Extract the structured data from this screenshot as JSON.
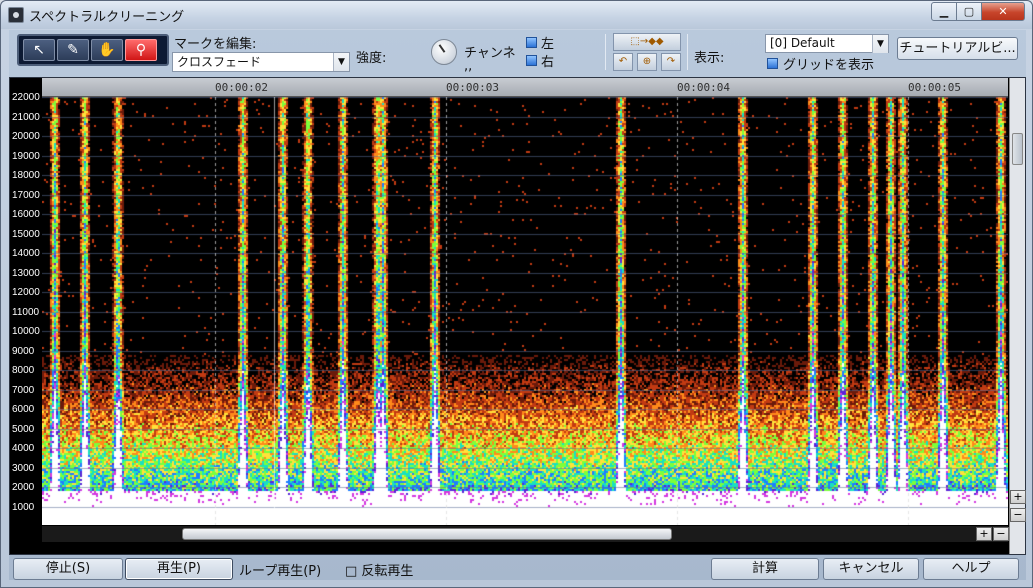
{
  "window": {
    "title": "スペクトラルクリーニング",
    "min": "▁",
    "max": "▢",
    "close": "✕"
  },
  "tools": [
    {
      "name": "pointer-tool",
      "glyph": "↖"
    },
    {
      "name": "brush-tool",
      "glyph": "✎"
    },
    {
      "name": "hand-tool",
      "glyph": "✋"
    },
    {
      "name": "zoom-tool",
      "glyph": "⚲"
    }
  ],
  "toolbar": {
    "mark_edit_label": "マークを編集:",
    "mark_edit_value": "クロスフェード",
    "strength_label": "強度:",
    "channel_label": "チャンネ\n,,",
    "left_label": "左",
    "right_label": "右",
    "view_label": "表示:",
    "preset_value": "[0] Default",
    "grid_label": "グリッドを表示",
    "tutorial_label": "チュートリアルビ..."
  },
  "icons": {
    "mark_arrow": "⬚→◆◆",
    "b1": "↶",
    "b2": "⊕",
    "b3": "↷"
  },
  "timeline": {
    "labels": [
      "00:00:02",
      "00:00:03",
      "00:00:04",
      "00:00:05"
    ]
  },
  "y_axis": {
    "labels": [
      "22000",
      "21000",
      "20000",
      "19000",
      "18000",
      "17000",
      "16000",
      "15000",
      "14000",
      "13000",
      "12000",
      "11000",
      "10000",
      "9000",
      "8000",
      "7000",
      "6000",
      "5000",
      "4000",
      "3000",
      "2000",
      "1000"
    ]
  },
  "scroll": {
    "plus": "+",
    "minus": "−"
  },
  "bottom": {
    "stop": "停止(S)",
    "play": "再生(P)",
    "loop": "ループ再生(P)",
    "reverse": "□ 反転再生",
    "calc": "計算",
    "cancel": "キャンセル",
    "help": "ヘルプ"
  }
}
